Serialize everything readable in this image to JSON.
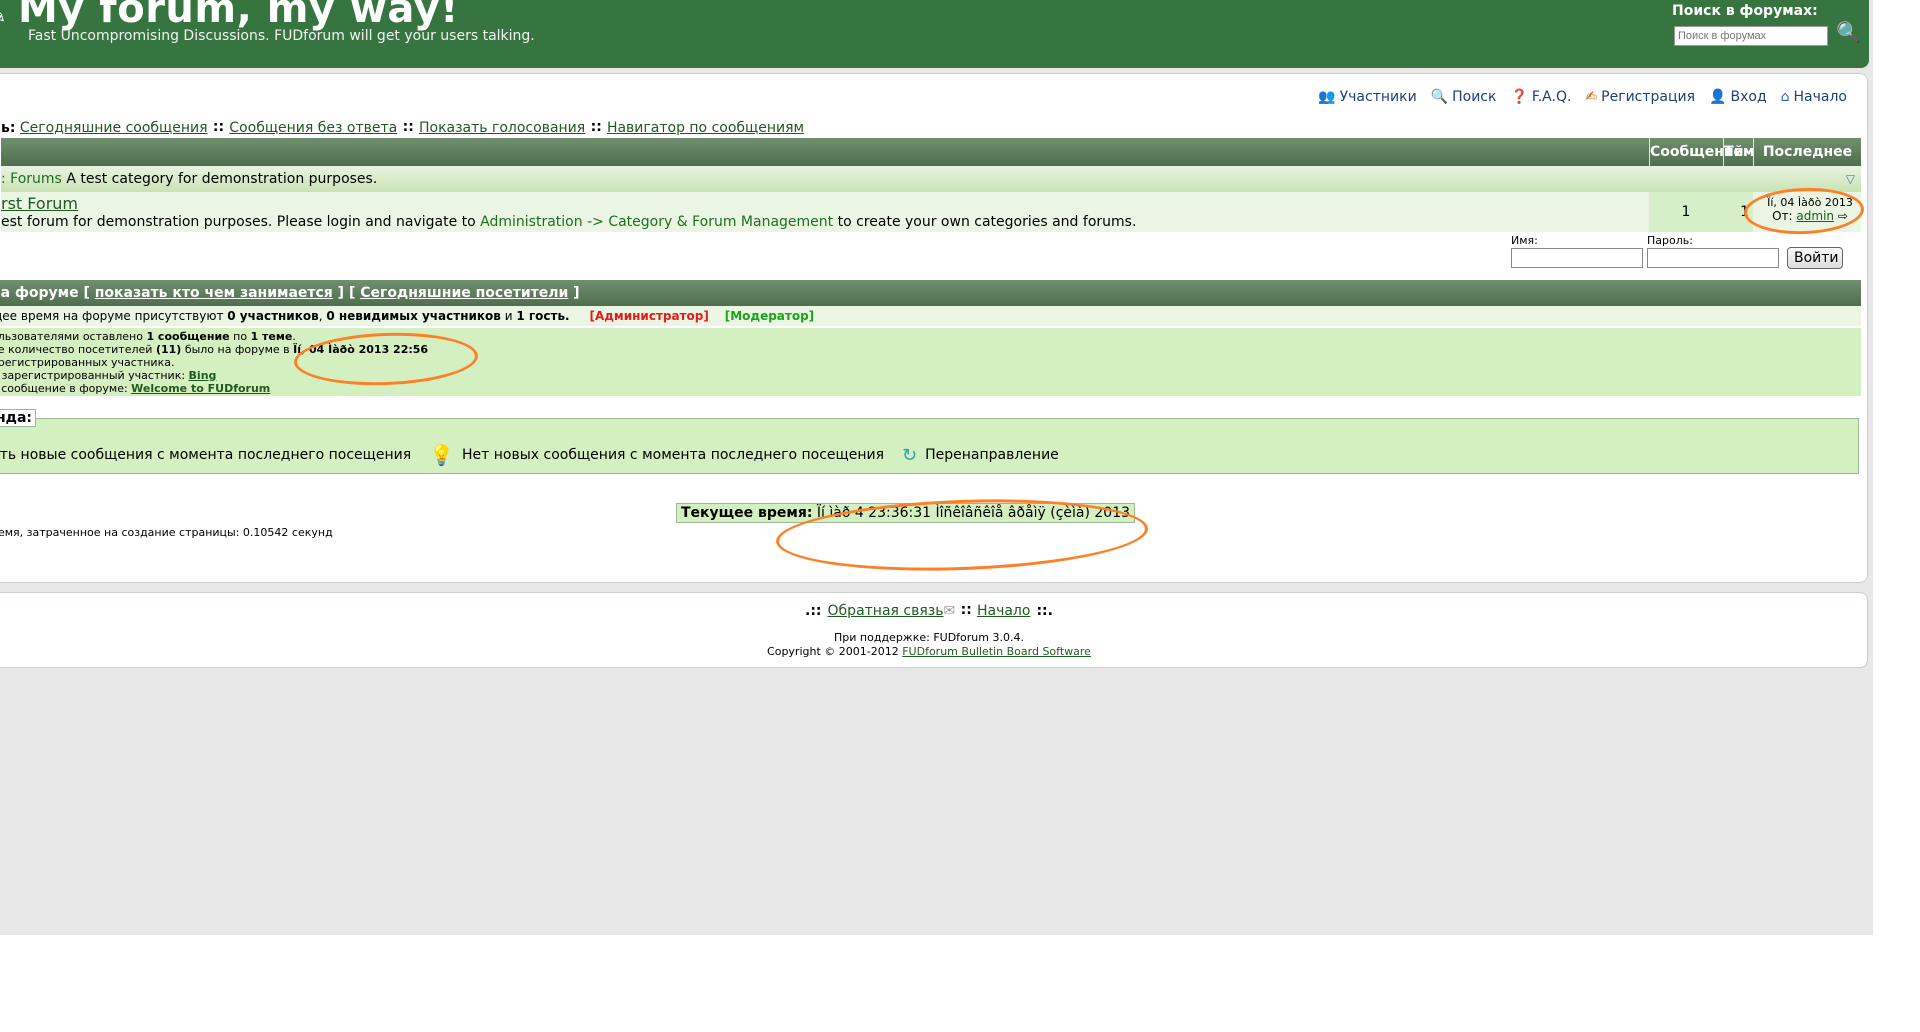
{
  "header": {
    "title": "My forum, my way!",
    "tagline": "Fast Uncompromising Discussions. FUDforum will get your users talking.",
    "search_label": "Поиск в форумах:",
    "search_placeholder": "Поиск в форумах"
  },
  "topnav": {
    "items": [
      {
        "label": "Участники",
        "icon": "users-icon"
      },
      {
        "label": "Поиск",
        "icon": "search-icon"
      },
      {
        "label": "F.A.Q.",
        "icon": "faq-icon"
      },
      {
        "label": "Регистрация",
        "icon": "register-icon"
      },
      {
        "label": "Вход",
        "icon": "login-icon"
      },
      {
        "label": "Начало",
        "icon": "home-icon"
      }
    ]
  },
  "quicklinks": {
    "prefix": "ь:",
    "items": [
      "Сегодняшние сообщения",
      "Сообщения без ответа",
      "Показать голосования",
      "Навигатор по сообщениям"
    ]
  },
  "forum_table": {
    "col_messages": "Сообщений",
    "col_topics": "Тем",
    "col_last": "Последнее",
    "category_name": ": Forums",
    "category_desc": "A test category for demonstration purposes.",
    "forum_name": "rst Forum",
    "forum_desc_start": "est forum for demonstration purposes. Please login and navigate to",
    "forum_desc_link1": "Administration",
    "forum_desc_arrow": "->",
    "forum_desc_link2": "Category & Forum Management",
    "forum_desc_end": "to create your own categories and forums.",
    "messages": "1",
    "topics": "1",
    "last_date": "Ïí, 04 Ìàðò 2013",
    "last_by_label": "От:",
    "last_by_user": "admin"
  },
  "login": {
    "name_label": "Имя:",
    "password_label": "Пароль:",
    "button": "Войти"
  },
  "online": {
    "title": "на форуме",
    "link1": "показать кто чем занимается",
    "link2": "Сегодняшние посетители",
    "row_prefix": "щее время на форуме присутствуют",
    "members": "0 участников",
    "invisible": "0 невидимых участников",
    "and": "и",
    "guests": "1 гость.",
    "admin_label": "[Администратор]",
    "mod_label": "[Модератор]"
  },
  "stats": {
    "line1_prefix": "ользователями оставлено",
    "line1_msgs": "1 сообщение",
    "line1_mid": "по",
    "line1_topics": "1 теме",
    "line2_prefix": "ее количество посетителей",
    "line2_count": "(11)",
    "line2_mid": "было на форуме в",
    "line2_date": "Ïí, 04 Ìàðò 2013 22:56",
    "line3": "арегистрированных участника.",
    "line4_prefix": "й зарегистрированный участник:",
    "line4_user": "Bing",
    "line5_prefix": "е сообщение в форуме:",
    "line5_link": "Welcome to FUDforum"
  },
  "legend": {
    "title": "нда:",
    "item1": "сть новые сообщения с момента последнего посещения",
    "item2": "Нет новых сообщения с момента последнего посещения",
    "item3": "Перенаправление"
  },
  "current_time": {
    "label": "Текущее время:",
    "value": "Ïí ìàð 4 23:36:31 Ìîñêîâñêîå âðåìÿ (çèìà) 2013"
  },
  "gen_time": "ремя, затраченное на создание страницы: 0.10542 секунд",
  "footer": {
    "feedback": "Обратная связь",
    "home": "Начало",
    "powered": "При поддержке: FUDforum 3.0.4.",
    "copyright_prefix": "Copyright © 2001-2012",
    "copyright_link": "FUDforum Bulletin Board Software"
  }
}
